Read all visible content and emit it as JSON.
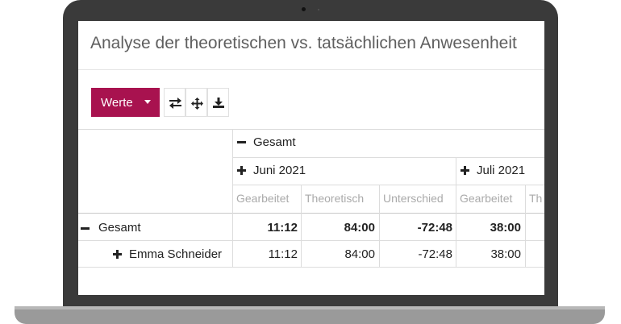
{
  "report": {
    "title": "Analyse der theoretischen vs. tatsächlichen Anwesenheit"
  },
  "toolbar": {
    "measures_label": "Werte",
    "icons": [
      "swap-axes-icon",
      "expand-all-icon",
      "download-icon"
    ]
  },
  "pivot": {
    "col_group_total": "Gesamt",
    "col_periods": [
      "Juni 2021",
      "Juli 2021"
    ],
    "measures": [
      "Gearbeitet",
      "Theoretisch",
      "Unterschied",
      "Gearbeitet",
      "Th"
    ],
    "rows": [
      {
        "label": "Gesamt",
        "expander": "minus",
        "values": [
          "11:12",
          "84:00",
          "-72:48",
          "38:00"
        ]
      },
      {
        "label": "Emma Schneider",
        "expander": "plus",
        "values": [
          "11:12",
          "84:00",
          "-72:48",
          "38:00"
        ]
      }
    ]
  },
  "colors": {
    "accent": "#a8124f",
    "frame": "#3a3a3a"
  }
}
